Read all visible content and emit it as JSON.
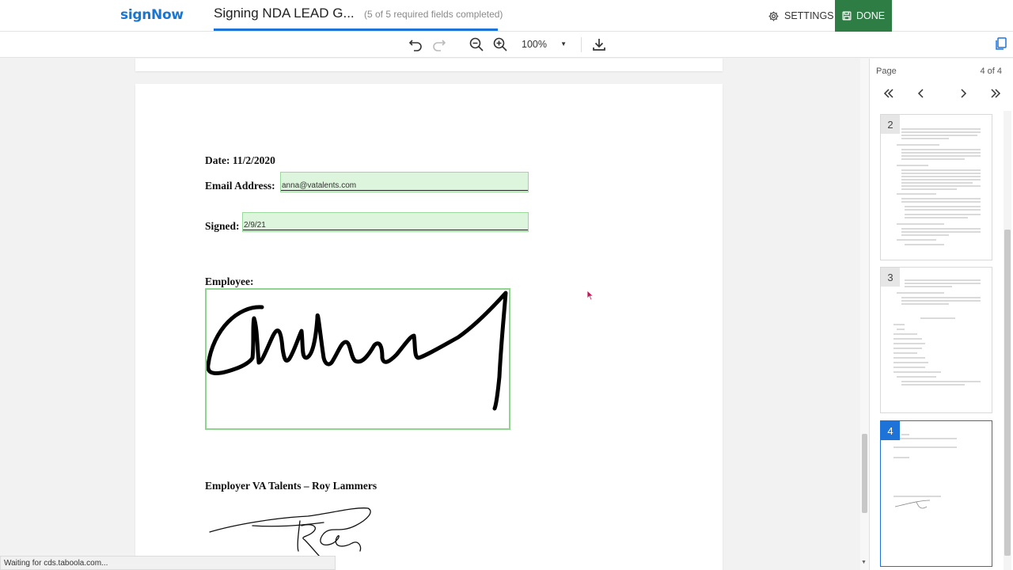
{
  "header": {
    "logo": "signNow",
    "document_title": "Signing NDA LEAD G...",
    "fields_status": "(5 of 5 required fields completed)",
    "settings_label": "SETTINGS",
    "done_label": "DONE"
  },
  "toolbar": {
    "zoom": "100%"
  },
  "document": {
    "date_line": "Date: 11/2/2020",
    "email_label": "Email Address:",
    "email_value": "anna@vatalents.com",
    "signed_label": "Signed:",
    "signed_value": "2/9/21",
    "employee_label": "Employee:",
    "employer_label": "Employer VA Talents – Roy Lammers"
  },
  "side_panel": {
    "page_label": "Page",
    "page_count": "4 of 4",
    "thumbnails": [
      {
        "number": "2"
      },
      {
        "number": "3"
      },
      {
        "number": "4"
      }
    ]
  },
  "status_bar": {
    "text": "Waiting for cds.taboola.com..."
  },
  "colors": {
    "brand": "#1976d2",
    "done_button": "#2e7d45",
    "field_fill": "#dcf5dc",
    "active_thumb": "#1e73d8"
  }
}
